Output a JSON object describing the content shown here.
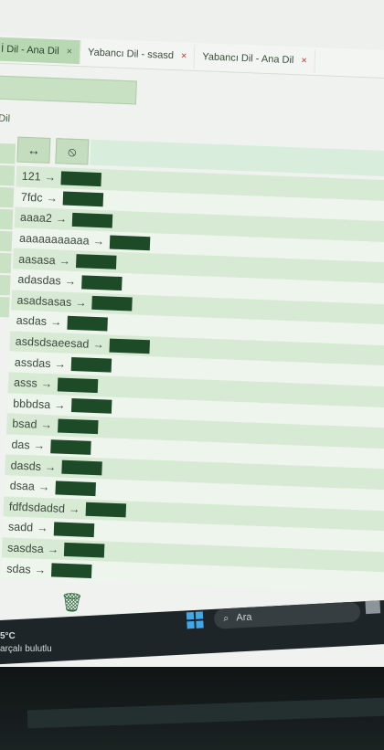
{
  "tabs": [
    {
      "label": "İ Dil - Ana Dil",
      "active": true
    },
    {
      "label": "Yabancı Dil - ssasd",
      "active": false
    },
    {
      "label": "Yabancı Dil - Ana Dil",
      "active": false
    }
  ],
  "tab_close": "×",
  "section_label": "Dil",
  "toolbar": {
    "swap_icon": "↔",
    "block_icon": "⦸"
  },
  "arrow": "→",
  "words": [
    "121",
    "7fdc",
    "aaaa2",
    "aaaaaaaaaaa",
    "aasasa",
    "adasdas",
    "asadsasas",
    "asdas",
    "asdsdsaeesad",
    "assdas",
    "asss",
    "bbbdsa",
    "bsad",
    "das",
    "dasds",
    "dsaa",
    "fdfdsdadsd",
    "sadd",
    "sasdsa",
    "sdas"
  ],
  "delete_icon": "trash-icon",
  "taskbar": {
    "search_label": "Ara"
  },
  "weather": {
    "temp": "5°C",
    "condition": "arçalı bulutlu"
  },
  "colors": {
    "accent": "#b8d8b3",
    "redact": "#1d4a27",
    "start": "#41a7e8"
  }
}
